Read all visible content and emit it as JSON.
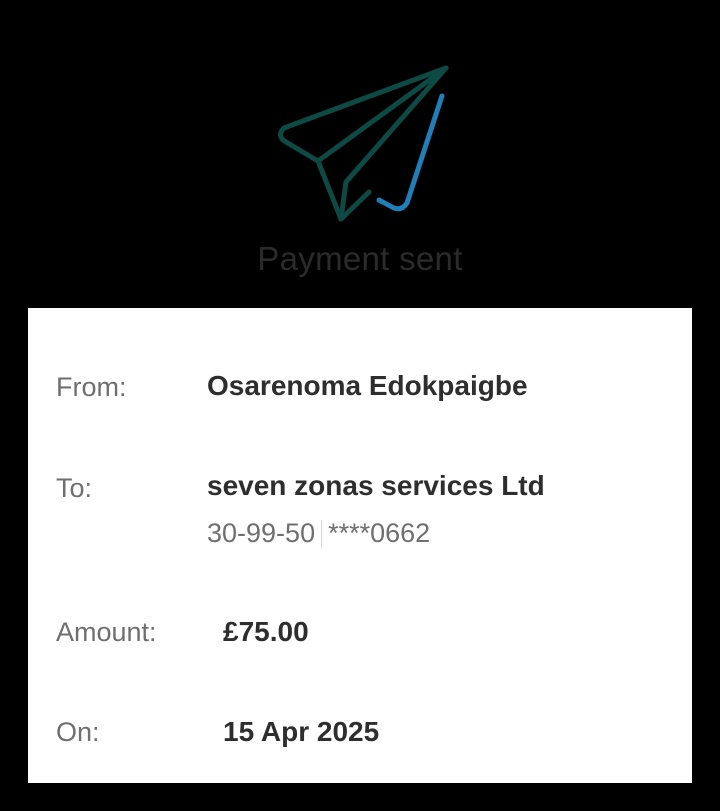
{
  "header": {
    "icon": "paper-plane-check-icon",
    "title": "Payment sent"
  },
  "details": {
    "from": {
      "label": "From:",
      "value": "Osarenoma Edokpaigbe"
    },
    "to": {
      "label": "To:",
      "value": "seven zonas services Ltd",
      "sort_code": "30-99-50",
      "account": "****0662"
    },
    "amount": {
      "label": "Amount:",
      "value": "£75.00"
    },
    "on": {
      "label": "On:",
      "value": "15 Apr 2025"
    }
  },
  "colors": {
    "background": "#000000",
    "plane": "#0e4a44",
    "check": "#1f7fb8",
    "card": "#ffffff"
  }
}
